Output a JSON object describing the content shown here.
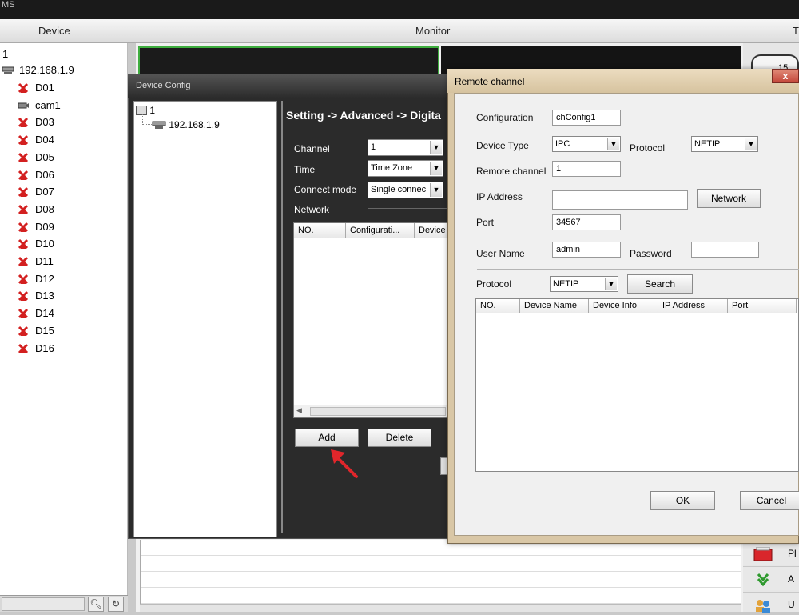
{
  "app": {
    "title_fragment": "MS"
  },
  "top_tabs": {
    "device": "Device",
    "monitor": "Monitor",
    "right_fragment": "T"
  },
  "device_tree": {
    "root": "1",
    "device_ip": "192.168.1.9",
    "channels": [
      "D01",
      "cam1",
      "D03",
      "D04",
      "D05",
      "D06",
      "D07",
      "D08",
      "D09",
      "D10",
      "D11",
      "D12",
      "D13",
      "D14",
      "D15",
      "D16"
    ],
    "online_channel": "cam1"
  },
  "right_panel": {
    "button_fragment": "15:",
    "items": [
      {
        "label": "Pl",
        "icon": "playback-icon"
      },
      {
        "label": "A",
        "icon": "download-icon"
      },
      {
        "label": "U",
        "icon": "users-icon"
      }
    ]
  },
  "device_config": {
    "title": "Device Config",
    "tree_root": "1",
    "tree_device": "192.168.1.9",
    "breadcrumb": "Setting -> Advanced -> Digita",
    "channel_label": "Channel",
    "channel_value": "1",
    "time_label": "Time",
    "time_value": "Time Zone",
    "connect_mode_label": "Connect mode",
    "connect_mode_value": "Single connec",
    "network_label": "Network",
    "list_headers": [
      "NO.",
      "Configurati...",
      "Device"
    ],
    "add_button": "Add",
    "delete_button": "Delete"
  },
  "remote_channel": {
    "title": "Remote channel",
    "close": "x",
    "configuration_label": "Configuration",
    "configuration_value": "chConfig1",
    "device_type_label": "Device Type",
    "device_type_value": "IPC",
    "protocol_label": "Protocol",
    "protocol_value": "NETIP",
    "remote_channel_label": "Remote channel",
    "remote_channel_value": "1",
    "ip_label": "IP Address",
    "ip_value": "",
    "network_button": "Network",
    "port_label": "Port",
    "port_value": "34567",
    "username_label": "User Name",
    "username_value": "admin",
    "password_label": "Password",
    "password_value": "",
    "search_protocol_label": "Protocol",
    "search_protocol_value": "NETIP",
    "search_button": "Search",
    "list_headers": [
      "NO.",
      "Device Name",
      "Device Info",
      "IP Address",
      "Port"
    ],
    "ok_button": "OK",
    "cancel_button": "Cancel"
  },
  "colors": {
    "annotation_arrow": "#e0262b",
    "offline_icon": "#d32020",
    "active_cell_border": "#3fae3f"
  }
}
